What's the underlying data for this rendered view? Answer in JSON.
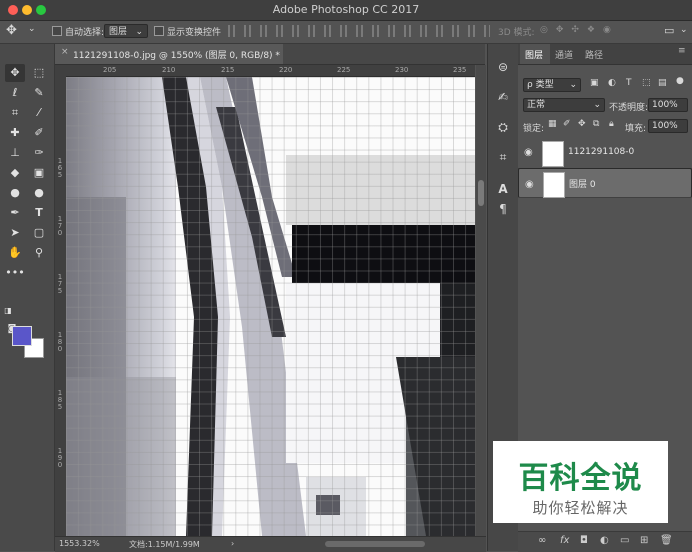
{
  "window": {
    "title": "Adobe Photoshop CC 2017"
  },
  "options_bar": {
    "auto_select_label": "自动选择:",
    "auto_select_value": "图层",
    "show_transform_label": "显示变换控件",
    "mode_3d_label": "3D 模式:"
  },
  "document": {
    "tab_title": "1121291108-0.jpg @ 1550% (图层 0, RGB/8) *",
    "close_glyph": "×"
  },
  "rulers": {
    "top_ticks": [
      "205",
      "210",
      "215",
      "220",
      "225",
      "230",
      "235"
    ],
    "left_ticks": [
      "165",
      "170",
      "175",
      "180",
      "185",
      "190"
    ]
  },
  "status_bar": {
    "zoom": "1553.32%",
    "doc_size": "文档:1.15M/1.99M",
    "arrow": "›"
  },
  "layers_panel": {
    "tabs": [
      "图层",
      "通道",
      "路径"
    ],
    "filter_kind": "ρ 类型",
    "blend_mode": "正常",
    "opacity_label": "不透明度:",
    "opacity_value": "100%",
    "lock_label": "锁定:",
    "fill_label": "填充:",
    "fill_value": "100%",
    "layers": [
      {
        "name": "1121291108-0",
        "selected": false
      },
      {
        "name": "图层 0",
        "selected": true
      }
    ],
    "bottom_icons": [
      "link-icon",
      "fx-icon",
      "mask-icon",
      "adjustment-icon",
      "folder-icon",
      "new-layer-icon",
      "trash-icon"
    ]
  },
  "colors": {
    "foreground": "#5a56c9",
    "background": "#ffffff",
    "watermark_green": "#1e8a4a"
  },
  "watermark": {
    "title": "百科全说",
    "subtitle": "助你轻松解决"
  }
}
